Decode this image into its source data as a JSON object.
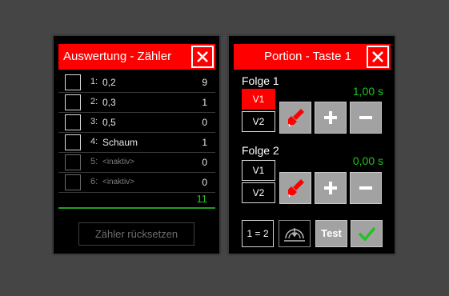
{
  "counter_panel": {
    "title": "Auswertung - Zähler",
    "rows": [
      {
        "index": "1:",
        "label": "0,2",
        "value": "9",
        "active": true
      },
      {
        "index": "2:",
        "label": "0,3",
        "value": "1",
        "active": true
      },
      {
        "index": "3:",
        "label": "0,5",
        "value": "0",
        "active": true
      },
      {
        "index": "4:",
        "label": "Schaum",
        "value": "1",
        "active": true
      },
      {
        "index": "5:",
        "label": "<inaktiv>",
        "value": "0",
        "active": false
      },
      {
        "index": "6:",
        "label": "<inaktiv>",
        "value": "0",
        "active": false
      }
    ],
    "total": "11",
    "reset_label": "Zähler rücksetzen"
  },
  "portion_panel": {
    "title": "Portion - Taste 1",
    "sequences": [
      {
        "label": "Folge 1",
        "time": "1,00 s",
        "v1": "V1",
        "v2": "V2",
        "active": "V1"
      },
      {
        "label": "Folge 2",
        "time": "0,00 s",
        "v1": "V1",
        "v2": "V2",
        "active": "none"
      }
    ],
    "link_label": "1 = 2",
    "test_label": "Test",
    "icons": [
      "close-icon",
      "pour-icon",
      "plus-icon",
      "minus-icon",
      "dispense-icon",
      "checkmark-icon"
    ]
  },
  "colors": {
    "background": "#454545",
    "title_bar": "#ff0000",
    "value_green": "#21c421",
    "button_gray": "#a2a2a2",
    "active_red": "#ff0000"
  }
}
